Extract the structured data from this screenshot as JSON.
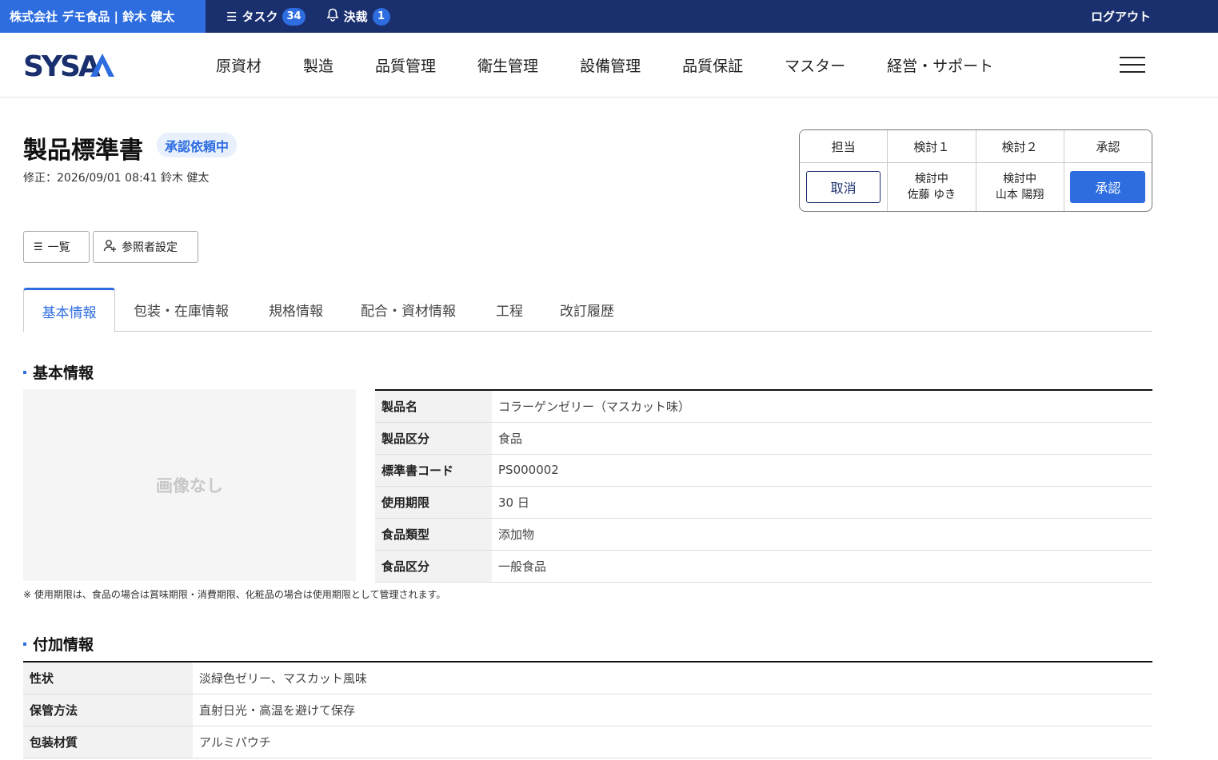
{
  "topbar": {
    "company": "株式会社 デモ食品 | 鈴木 健太",
    "task_label": "タスク",
    "task_count": "34",
    "approval_label": "決裁",
    "approval_count": "1",
    "logout": "ログアウト"
  },
  "logo_text": "SYSA",
  "nav": [
    "原資材",
    "製造",
    "品質管理",
    "衛生管理",
    "設備管理",
    "品質保証",
    "マスター",
    "経営・サポート"
  ],
  "page": {
    "title": "製品標準書",
    "status": "承認依頼中",
    "modified": "修正：2026/09/01 08:41 鈴木 健太"
  },
  "approval": {
    "headers": [
      "担当",
      "検討１",
      "検討２",
      "承認"
    ],
    "cancel_label": "取消",
    "review1": {
      "state": "検討中",
      "person": "佐藤 ゆき"
    },
    "review2": {
      "state": "検討中",
      "person": "山本 陽翔"
    },
    "approve_label": "承認"
  },
  "actions": {
    "list": "一覧",
    "viewers": "参照者設定"
  },
  "tabs": [
    "基本情報",
    "包装・在庫情報",
    "規格情報",
    "配合・資材情報",
    "工程",
    "改訂履歴"
  ],
  "basic": {
    "heading": "基本情報",
    "no_image": "画像なし",
    "rows": [
      {
        "label": "製品名",
        "value": "コラーゲンゼリー（マスカット味）"
      },
      {
        "label": "製品区分",
        "value": "食品"
      },
      {
        "label": "標準書コード",
        "value": "PS000002"
      },
      {
        "label": "使用期限",
        "value": "30 日"
      },
      {
        "label": "食品類型",
        "value": "添加物"
      },
      {
        "label": "食品区分",
        "value": "一般食品"
      }
    ],
    "note": "※ 使用期限は、食品の場合は賞味期限・消費期限、化粧品の場合は使用期限として管理されます。"
  },
  "extra": {
    "heading": "付加情報",
    "rows": [
      {
        "label": "性状",
        "value": "淡緑色ゼリー、マスカット風味"
      },
      {
        "label": "保管方法",
        "value": "直射日光・高温を避けて保存"
      },
      {
        "label": "包装材質",
        "value": "アルミパウチ"
      }
    ]
  },
  "colors": {
    "navy": "#1a2f6e",
    "accent": "#2e6de0"
  }
}
